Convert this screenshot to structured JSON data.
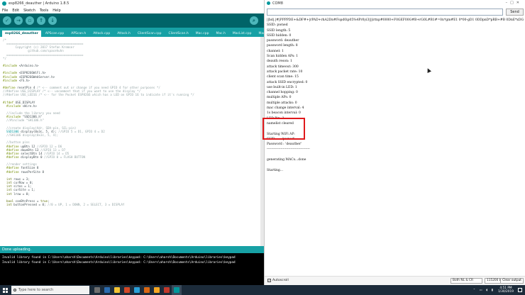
{
  "ide": {
    "title": "esp8266_deauther | Arduino 1.8.5",
    "menu": [
      "File",
      "Edit",
      "Sketch",
      "Tools",
      "Help"
    ],
    "tabs": [
      "esp8266_deauther",
      "APScan.cpp",
      "APScan.h",
      "Attack.cpp",
      "Attack.h",
      "ClientScan.cpp",
      "ClientScan.h",
      "Mac.cpp",
      "Mac.h",
      "MacList.cpp",
      "MacList.h"
    ],
    "status": "Done uploading.",
    "console": [
      "Invalid library found in C:\\Users\\aharsh\\Documents\\Arduino\\libraries\\keypad: C:\\Users\\aharsh\\Documents\\Arduino\\libraries\\keypad",
      "Invalid library found in C:\\Users\\aharsh\\Documents\\Arduino\\libraries\\keypad: C:\\Users\\aharsh\\Documents\\Arduino\\libraries\\keypad"
    ]
  },
  "serial": {
    "title": "COM8",
    "send_label": "Send",
    "lines": [
      "||bd|.|#|PPPPDE+&DF#+|rPAD+rhA2Dn#Fopd0ip05%4Pr0yi3|||irtnp#0000+F0GEF00G#B+rG0L#B1#=0n*gm#E1 0*00-gD1 0DDpnD*pRB+#B 0DnE*xDG+#E 0+v#D0+2DBnsuDG+",
      "SSID: pwned",
      "SSID length: 5",
      "SSID hidden: 0",
      "password: deauther",
      "password length: 8",
      "channel: 1",
      "Scan hidden APs: 1",
      "deauth reson: 1",
      "attack timeout: 300",
      "attack packet rate: 10",
      "client scan time: 15",
      "attack SSID encrypted: 0",
      "use built-in LED: 1",
      "channel hopping: 0",
      "multiple APs: 0",
      "multiple attacks: 0",
      "mac change interval: 4",
      "1s beacon interval: 0",
      "LED Pin: 2",
      "namelist cleared",
      "",
      "Starting WiFi AP:",
      "SSID     : 'pwned'",
      "Password : 'deauther'",
      "----------------------------------------",
      "",
      "generating MACs...done",
      "",
      "Starting..."
    ],
    "autoscroll_label": "Autoscroll",
    "autoscroll_checked": true,
    "line_ending": "Both NL & CR",
    "baud": "115200 baud",
    "clear_label": "Clear output"
  },
  "taskbar": {
    "search_placeholder": "Type here to search",
    "time": "4:51 PM",
    "date": "1/30/2019",
    "app_colors": [
      "#6f6f6f",
      "#2b6cb0",
      "#f2c233",
      "#d24726",
      "#2aa0d8",
      "#d86613",
      "#f5a623",
      "#c0392b",
      "#00979c"
    ]
  },
  "colors": {
    "teal_dark": "#006468",
    "teal": "#17a1a5",
    "highlight": "#e0191c"
  }
}
